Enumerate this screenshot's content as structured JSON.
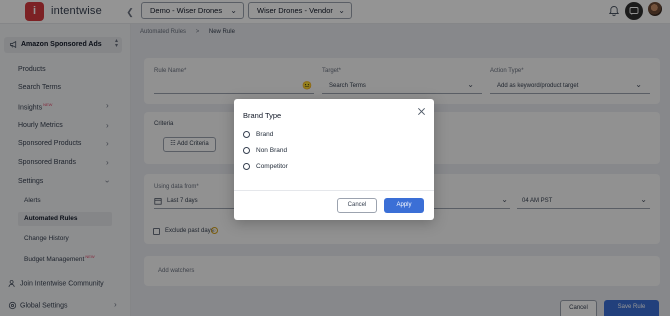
{
  "brand": {
    "logo_letter": "i",
    "name": "intentwise"
  },
  "topbar": {
    "account_select": "Demo - Wiser Drones",
    "profile_select": "Wiser Drones - Vendor"
  },
  "sidebar": {
    "header": "Amazon Sponsored Ads",
    "items": [
      {
        "label": "Products"
      },
      {
        "label": "Search Terms"
      },
      {
        "label": "Insights",
        "badge": "NEW"
      },
      {
        "label": "Hourly Metrics"
      },
      {
        "label": "Sponsored Products"
      },
      {
        "label": "Sponsored Brands"
      },
      {
        "label": "Settings"
      }
    ],
    "settings_children": [
      {
        "label": "Alerts"
      },
      {
        "label": "Automated Rules"
      },
      {
        "label": "Change History"
      },
      {
        "label": "Budget Management",
        "badge": "NEW"
      }
    ],
    "community": "Join Intentwise Community",
    "global_settings": "Global Settings"
  },
  "breadcrumb": {
    "parent": "Automated Rules",
    "separator": ">",
    "current": "New Rule"
  },
  "form": {
    "rule_name_label": "Rule Name*",
    "target_label": "Target*",
    "target_value": "Search Terms",
    "action_type_label": "Action Type*",
    "action_type_value": "Add as keyword/product target",
    "criteria_label": "Criteria",
    "add_criteria_label": "Add Criteria",
    "using_data_label": "Using data from*",
    "date_range_value": "Last 7 days",
    "time_value": "04 AM PST",
    "exclude_label": "Exclude past days",
    "add_watchers_placeholder": "Add watchers",
    "footer_cancel": "Cancel",
    "footer_save": "Save Rule"
  },
  "modal": {
    "title": "Brand Type",
    "options": [
      {
        "label": "Brand"
      },
      {
        "label": "Non Brand"
      },
      {
        "label": "Competitor"
      }
    ],
    "cancel_label": "Cancel",
    "apply_label": "Apply"
  },
  "colors": {
    "brand_red": "#d63a3f",
    "primary_blue": "#3b6fd6",
    "sidebar_bg": "#f3f4f6",
    "overlay": "rgba(0,0,0,0.42)"
  },
  "icons": {
    "menu_collapse": "chevron-left-icon",
    "notifications": "bell-icon",
    "chat": "chat-icon",
    "header": "megaphone-icon",
    "close": "close-icon"
  }
}
